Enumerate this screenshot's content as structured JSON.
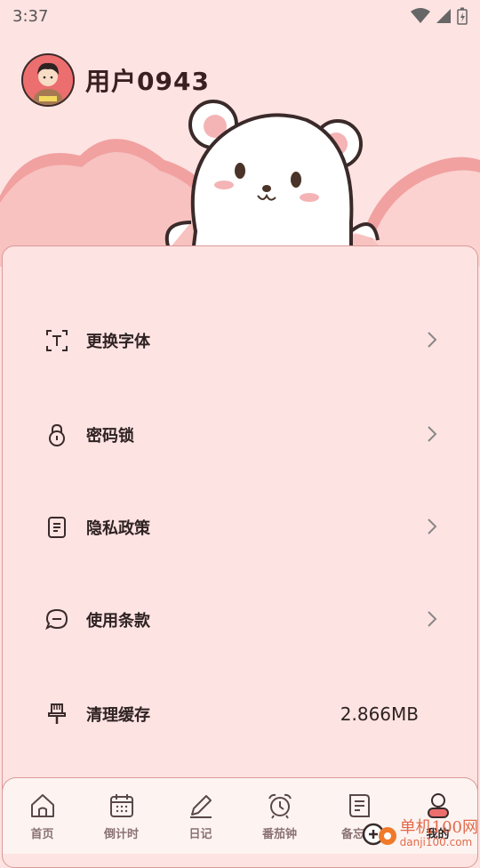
{
  "status_bar": {
    "time": "3:37"
  },
  "profile": {
    "username": "用户0943"
  },
  "menu": {
    "items": [
      {
        "label": "更换字体",
        "icon": "font-icon",
        "has_chevron": true
      },
      {
        "label": "密码锁",
        "icon": "lock-icon",
        "has_chevron": true
      },
      {
        "label": "隐私政策",
        "icon": "document-icon",
        "has_chevron": true
      },
      {
        "label": "使用条款",
        "icon": "chat-icon",
        "has_chevron": true
      },
      {
        "label": "清理缓存",
        "icon": "brush-icon",
        "value": "2.866MB"
      }
    ]
  },
  "bottom_nav": {
    "items": [
      {
        "label": "首页",
        "icon": "home-icon"
      },
      {
        "label": "倒计时",
        "icon": "calendar-icon"
      },
      {
        "label": "日记",
        "icon": "pen-icon"
      },
      {
        "label": "番茄钟",
        "icon": "alarm-clock-icon"
      },
      {
        "label": "备忘录",
        "icon": "memo-icon"
      },
      {
        "label": "我的",
        "icon": "person-icon",
        "active": true
      }
    ]
  },
  "watermark": {
    "name": "单机100网",
    "url": "danji100.com"
  },
  "colors": {
    "background": "#fde3e2",
    "accent": "#ec6e6e",
    "text": "#2e2222"
  }
}
